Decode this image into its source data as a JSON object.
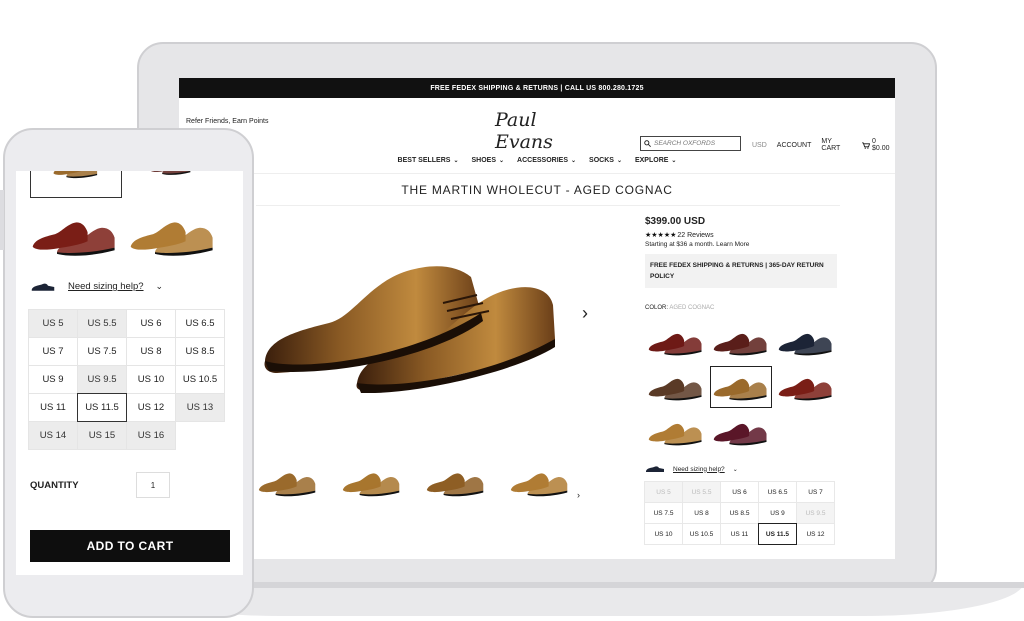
{
  "desktop": {
    "topbar": "FREE FEDEX SHIPPING & RETURNS | CALL US 800.280.1725",
    "refer": "Refer Friends, Earn Points",
    "logo": "Paul Evans",
    "search_placeholder": "SEARCH OXFORDS",
    "currency": "USD",
    "account": "ACCOUNT",
    "cart": "MY CART",
    "cart_summary": "0  $0.00",
    "nav": [
      "BEST SELLERS",
      "SHOES",
      "ACCESSORIES",
      "SOCKS",
      "EXPLORE"
    ],
    "product_title": "THE MARTIN WHOLECUT - AGED COGNAC",
    "price": "$399.00 USD",
    "rating_stars": 5,
    "reviews": "22 Reviews",
    "financing": "Starting at $36 a month. Learn More",
    "shipping_note": "FREE FEDEX SHIPPING & RETURNS | 365-DAY RETURN POLICY",
    "color_label": "COLOR:",
    "color_value": "AGED COGNAC",
    "sizing_help": "Need sizing help?",
    "sizes": [
      {
        "label": "US 5",
        "available": false
      },
      {
        "label": "US 5.5",
        "available": false
      },
      {
        "label": "US 6",
        "available": true
      },
      {
        "label": "US 6.5",
        "available": true
      },
      {
        "label": "US 7",
        "available": true
      },
      {
        "label": "US 7.5",
        "available": true
      },
      {
        "label": "US 8",
        "available": true
      },
      {
        "label": "US 8.5",
        "available": true
      },
      {
        "label": "US 9",
        "available": true
      },
      {
        "label": "US 9.5",
        "available": false
      },
      {
        "label": "US 10",
        "available": true
      },
      {
        "label": "US 10.5",
        "available": true
      },
      {
        "label": "US 11",
        "available": true
      },
      {
        "label": "US 11.5",
        "available": true,
        "selected": true
      },
      {
        "label": "US 12",
        "available": true
      }
    ]
  },
  "mobile": {
    "sizing_help": "Need sizing help?",
    "sizes": [
      {
        "label": "US 5",
        "available": false
      },
      {
        "label": "US 5.5",
        "available": false
      },
      {
        "label": "US 6",
        "available": true
      },
      {
        "label": "US 6.5",
        "available": true
      },
      {
        "label": "US 7",
        "available": true
      },
      {
        "label": "US 7.5",
        "available": true
      },
      {
        "label": "US 8",
        "available": true
      },
      {
        "label": "US 8.5",
        "available": true
      },
      {
        "label": "US 9",
        "available": true
      },
      {
        "label": "US 9.5",
        "available": false
      },
      {
        "label": "US 10",
        "available": true
      },
      {
        "label": "US 10.5",
        "available": true
      },
      {
        "label": "US 11",
        "available": true
      },
      {
        "label": "US 11.5",
        "available": true,
        "selected": true
      },
      {
        "label": "US 12",
        "available": true
      },
      {
        "label": "US 13",
        "available": false
      },
      {
        "label": "US 14",
        "available": false
      },
      {
        "label": "US 15",
        "available": false
      },
      {
        "label": "US 16",
        "available": false
      }
    ],
    "quantity_label": "QUANTITY",
    "quantity_value": "1",
    "add_to_cart": "ADD TO CART"
  },
  "colors": {
    "cognac": "#9a6a2c",
    "dark_brown": "#4a2a12",
    "oxblood": "#6e1a16",
    "navy": "#1c2436",
    "chocolate": "#5a3a26",
    "burgundy": "#5a1628"
  }
}
